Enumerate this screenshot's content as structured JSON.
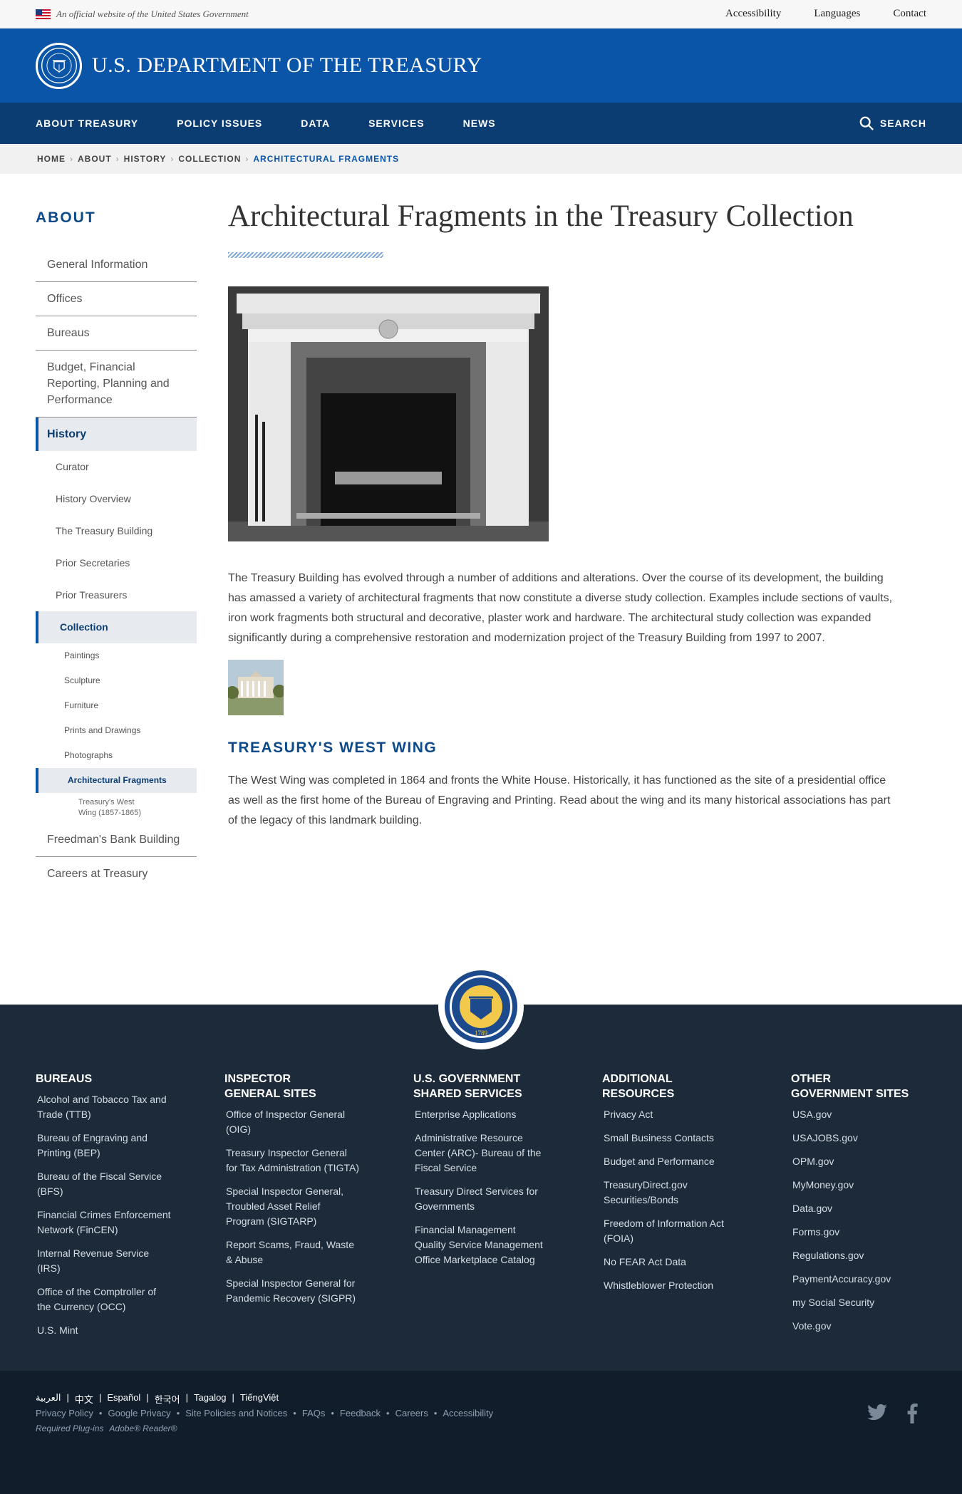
{
  "gov_banner": {
    "text": "An official website of the United States Government",
    "links": [
      "Accessibility",
      "Languages",
      "Contact"
    ]
  },
  "header": {
    "title": "U.S. DEPARTMENT OF THE TREASURY"
  },
  "nav": {
    "items": [
      "ABOUT TREASURY",
      "POLICY ISSUES",
      "DATA",
      "SERVICES",
      "NEWS"
    ],
    "search_label": "SEARCH"
  },
  "breadcrumb": [
    "HOME",
    "ABOUT",
    "HISTORY",
    "COLLECTION",
    "ARCHITECTURAL FRAGMENTS"
  ],
  "sidebar": {
    "heading": "ABOUT",
    "items": [
      "General Information",
      "Offices",
      "Bureaus",
      "Budget, Financial Reporting, Planning and Performance",
      "History",
      "Freedman's Bank Building",
      "Careers at Treasury"
    ],
    "history_children": [
      "Curator",
      "History Overview",
      "The Treasury Building",
      "Prior Secretaries",
      "Prior Treasurers",
      "Collection"
    ],
    "collection_children": [
      "Paintings",
      "Sculpture",
      "Furniture",
      "Prints and Drawings",
      "Photographs",
      "Architectural Fragments"
    ],
    "fragment_children": [
      "Treasury's West Wing (1857-1865)"
    ]
  },
  "main": {
    "title": "Architectural Fragments in the Treasury Collection",
    "paragraph": "The Treasury Building has evolved through a number of additions and alterations. Over the course of its development, the building has amassed a variety of architectural fragments that now constitute a diverse study collection. Examples include sections of vaults, iron work fragments both structural and decorative, plaster work and hardware. The architectural study collection was expanded significantly during a comprehensive restoration and modernization project of the Treasury Building from 1997 to 2007.",
    "section_heading": "TREASURY'S WEST WING",
    "section_paragraph": "The West Wing was completed in 1864 and fronts the White House. Historically, it has functioned as the site of a presidential office as well as the first home of the Bureau of Engraving and Printing. Read about the wing and its many historical associations has part of the legacy of this landmark building."
  },
  "footer": {
    "seal_year": "1789",
    "columns": [
      {
        "title": "BUREAUS",
        "links": [
          "Alcohol and Tobacco Tax and Trade (TTB)",
          "Bureau of Engraving and Printing (BEP)",
          "Bureau of the Fiscal Service (BFS)",
          "Financial Crimes Enforcement Network (FinCEN)",
          "Internal Revenue Service (IRS)",
          "Office of the Comptroller of the Currency (OCC)",
          "U.S. Mint"
        ]
      },
      {
        "title": "INSPECTOR GENERAL SITES",
        "links": [
          "Office of Inspector General (OIG)",
          "Treasury Inspector General for Tax Administration (TIGTA)",
          "Special Inspector General, Troubled Asset Relief Program (SIGTARP)",
          "Report Scams, Fraud, Waste & Abuse",
          "Special Inspector General for Pandemic Recovery (SIGPR)"
        ]
      },
      {
        "title": "U.S. GOVERNMENT SHARED SERVICES",
        "links": [
          "Enterprise Applications",
          "Administrative Resource Center (ARC)- Bureau of the Fiscal Service",
          "Treasury Direct Services for Governments",
          "Financial Management Quality Service Management Office Marketplace Catalog"
        ]
      },
      {
        "title": "ADDITIONAL RESOURCES",
        "links": [
          "Privacy Act",
          "Small Business Contacts",
          "Budget and Performance",
          "TreasuryDirect.gov Securities/Bonds",
          "Freedom of Information Act (FOIA)",
          "No FEAR Act Data",
          "Whistleblower Protection"
        ]
      },
      {
        "title": "OTHER GOVERNMENT SITES",
        "links": [
          "USA.gov",
          "USAJOBS.gov",
          "OPM.gov",
          "MyMoney.gov",
          "Data.gov",
          "Forms.gov",
          "Regulations.gov",
          "PaymentAccuracy.gov",
          "my Social Security",
          "Vote.gov"
        ]
      }
    ]
  },
  "subfooter": {
    "languages": [
      "العربية",
      "中文",
      "Español",
      "한국어",
      "Tagalog",
      "TiếngViệt"
    ],
    "legal": [
      "Privacy Policy",
      "Google Privacy",
      "Site Policies and Notices",
      "FAQs",
      "Feedback",
      "Careers",
      "Accessibility"
    ],
    "plugins_label": "Required Plug-ins",
    "plugins": [
      "Adobe® Reader®"
    ]
  },
  "icons": {
    "twitter": "twitter-icon",
    "facebook": "facebook-icon",
    "search": "search-icon"
  },
  "colors": {
    "primary_blue": "#0a55a8",
    "nav_navy": "#0c3d72",
    "footer_bg": "#1c2a3a"
  }
}
